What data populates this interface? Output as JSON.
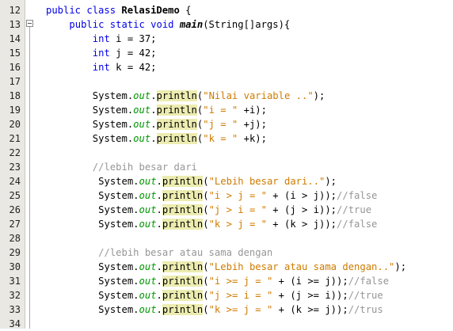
{
  "editor": {
    "lines": [
      {
        "n": "12",
        "indent": 0,
        "tokens": [
          {
            "t": "kw",
            "v": "public"
          },
          {
            "t": "p",
            "v": " "
          },
          {
            "t": "kw",
            "v": "class"
          },
          {
            "t": "p",
            "v": " "
          },
          {
            "t": "cls",
            "v": "RelasiDemo"
          },
          {
            "t": "p",
            "v": " {"
          }
        ]
      },
      {
        "n": "13",
        "indent": 4,
        "fold": true,
        "tokens": [
          {
            "t": "kw",
            "v": "public"
          },
          {
            "t": "p",
            "v": " "
          },
          {
            "t": "kw",
            "v": "static"
          },
          {
            "t": "p",
            "v": " "
          },
          {
            "t": "kw",
            "v": "void"
          },
          {
            "t": "p",
            "v": " "
          },
          {
            "t": "method",
            "v": "main"
          },
          {
            "t": "p",
            "v": "(String[]args){"
          }
        ]
      },
      {
        "n": "14",
        "indent": 8,
        "tokens": [
          {
            "t": "kw",
            "v": "int"
          },
          {
            "t": "p",
            "v": " i = 37;"
          }
        ]
      },
      {
        "n": "15",
        "indent": 8,
        "tokens": [
          {
            "t": "kw",
            "v": "int"
          },
          {
            "t": "p",
            "v": " j = 42;"
          }
        ]
      },
      {
        "n": "16",
        "indent": 8,
        "tokens": [
          {
            "t": "kw",
            "v": "int"
          },
          {
            "t": "p",
            "v": " k = 42;"
          }
        ]
      },
      {
        "n": "17",
        "indent": 0,
        "tokens": []
      },
      {
        "n": "18",
        "indent": 8,
        "tokens": [
          {
            "t": "p",
            "v": "System."
          },
          {
            "t": "out",
            "v": "out"
          },
          {
            "t": "p",
            "v": "."
          },
          {
            "t": "hl",
            "v": "println"
          },
          {
            "t": "p",
            "v": "("
          },
          {
            "t": "str",
            "v": "\"Nilai variable ..\""
          },
          {
            "t": "p",
            "v": ");"
          }
        ]
      },
      {
        "n": "19",
        "indent": 8,
        "tokens": [
          {
            "t": "p",
            "v": "System."
          },
          {
            "t": "out",
            "v": "out"
          },
          {
            "t": "p",
            "v": "."
          },
          {
            "t": "hl",
            "v": "println"
          },
          {
            "t": "p",
            "v": "("
          },
          {
            "t": "str",
            "v": "\"i = \""
          },
          {
            "t": "p",
            "v": " +i);"
          }
        ]
      },
      {
        "n": "20",
        "indent": 8,
        "tokens": [
          {
            "t": "p",
            "v": "System."
          },
          {
            "t": "out",
            "v": "out"
          },
          {
            "t": "p",
            "v": "."
          },
          {
            "t": "hl",
            "v": "println"
          },
          {
            "t": "p",
            "v": "("
          },
          {
            "t": "str",
            "v": "\"j = \""
          },
          {
            "t": "p",
            "v": " +j);"
          }
        ]
      },
      {
        "n": "21",
        "indent": 8,
        "tokens": [
          {
            "t": "p",
            "v": "System."
          },
          {
            "t": "out",
            "v": "out"
          },
          {
            "t": "p",
            "v": "."
          },
          {
            "t": "hl",
            "v": "println"
          },
          {
            "t": "p",
            "v": "("
          },
          {
            "t": "str",
            "v": "\"k = \""
          },
          {
            "t": "p",
            "v": " +k);"
          }
        ]
      },
      {
        "n": "22",
        "indent": 0,
        "tokens": []
      },
      {
        "n": "23",
        "indent": 8,
        "tokens": [
          {
            "t": "cmt",
            "v": "//lebih besar dari"
          }
        ]
      },
      {
        "n": "24",
        "indent": 9,
        "tokens": [
          {
            "t": "p",
            "v": "System."
          },
          {
            "t": "out",
            "v": "out"
          },
          {
            "t": "p",
            "v": "."
          },
          {
            "t": "hl",
            "v": "println"
          },
          {
            "t": "p",
            "v": "("
          },
          {
            "t": "str",
            "v": "\"Lebih besar dari..\""
          },
          {
            "t": "p",
            "v": ");"
          }
        ]
      },
      {
        "n": "25",
        "indent": 9,
        "tokens": [
          {
            "t": "p",
            "v": "System."
          },
          {
            "t": "out",
            "v": "out"
          },
          {
            "t": "p",
            "v": "."
          },
          {
            "t": "hl",
            "v": "println"
          },
          {
            "t": "p",
            "v": "("
          },
          {
            "t": "str",
            "v": "\"i > j = \""
          },
          {
            "t": "p",
            "v": " + (i > j));"
          },
          {
            "t": "cmt",
            "v": "//false"
          }
        ]
      },
      {
        "n": "26",
        "indent": 9,
        "tokens": [
          {
            "t": "p",
            "v": "System."
          },
          {
            "t": "out",
            "v": "out"
          },
          {
            "t": "p",
            "v": "."
          },
          {
            "t": "hl",
            "v": "println"
          },
          {
            "t": "p",
            "v": "("
          },
          {
            "t": "str",
            "v": "\"j > i = \""
          },
          {
            "t": "p",
            "v": " + (j > i));"
          },
          {
            "t": "cmt",
            "v": "//true"
          }
        ]
      },
      {
        "n": "27",
        "indent": 9,
        "tokens": [
          {
            "t": "p",
            "v": "System."
          },
          {
            "t": "out",
            "v": "out"
          },
          {
            "t": "p",
            "v": "."
          },
          {
            "t": "hl",
            "v": "println"
          },
          {
            "t": "p",
            "v": "("
          },
          {
            "t": "str",
            "v": "\"k > j = \""
          },
          {
            "t": "p",
            "v": " + (k > j));"
          },
          {
            "t": "cmt",
            "v": "//false"
          }
        ]
      },
      {
        "n": "28",
        "indent": 0,
        "tokens": []
      },
      {
        "n": "29",
        "indent": 9,
        "tokens": [
          {
            "t": "cmt",
            "v": "//lebih besar atau sama dengan"
          }
        ]
      },
      {
        "n": "30",
        "indent": 9,
        "tokens": [
          {
            "t": "p",
            "v": "System."
          },
          {
            "t": "out",
            "v": "out"
          },
          {
            "t": "p",
            "v": "."
          },
          {
            "t": "hl",
            "v": "println"
          },
          {
            "t": "p",
            "v": "("
          },
          {
            "t": "str",
            "v": "\"Lebih besar atau sama dengan..\""
          },
          {
            "t": "p",
            "v": ");"
          }
        ]
      },
      {
        "n": "31",
        "indent": 9,
        "tokens": [
          {
            "t": "p",
            "v": "System."
          },
          {
            "t": "out",
            "v": "out"
          },
          {
            "t": "p",
            "v": "."
          },
          {
            "t": "hl",
            "v": "println"
          },
          {
            "t": "p",
            "v": "("
          },
          {
            "t": "str",
            "v": "\"i >= j = \""
          },
          {
            "t": "p",
            "v": " + (i >= j));"
          },
          {
            "t": "cmt",
            "v": "//false"
          }
        ]
      },
      {
        "n": "32",
        "indent": 9,
        "tokens": [
          {
            "t": "p",
            "v": "System."
          },
          {
            "t": "out",
            "v": "out"
          },
          {
            "t": "p",
            "v": "."
          },
          {
            "t": "hl",
            "v": "println"
          },
          {
            "t": "p",
            "v": "("
          },
          {
            "t": "str",
            "v": "\"j >= i = \""
          },
          {
            "t": "p",
            "v": " + (j >= i));"
          },
          {
            "t": "cmt",
            "v": "//true"
          }
        ]
      },
      {
        "n": "33",
        "indent": 9,
        "tokens": [
          {
            "t": "p",
            "v": "System."
          },
          {
            "t": "out",
            "v": "out"
          },
          {
            "t": "p",
            "v": "."
          },
          {
            "t": "hl",
            "v": "println"
          },
          {
            "t": "p",
            "v": "("
          },
          {
            "t": "str",
            "v": "\"k >= j = \""
          },
          {
            "t": "p",
            "v": " + (k >= j));"
          },
          {
            "t": "cmt",
            "v": "//trus"
          }
        ]
      },
      {
        "n": "34",
        "indent": 0,
        "tokens": []
      }
    ]
  },
  "colors": {
    "keyword": "#0000e6",
    "string": "#ce7b00",
    "out_field": "#009900",
    "comment": "#969696",
    "highlight": "#ececb0",
    "gutter": "#e9e8e2"
  }
}
